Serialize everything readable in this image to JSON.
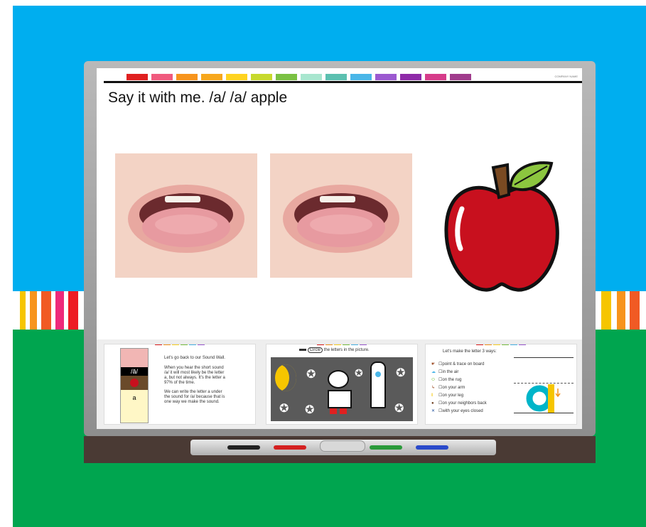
{
  "slide": {
    "title": "Say it with me.  /a/ /a/ apple",
    "corner_label": "COMPANY NAME"
  },
  "panels": {
    "sound_wall": {
      "intro": "Let's go back to our Sound Wall.",
      "line1": "When you hear the short sound",
      "line2": "/a/ it will most likely be the letter",
      "line3": "a, but not always. It's the letter a",
      "line4": "97% of the time.",
      "line5": "We can write the letter a under",
      "line6": "the sound for /a/ because that is",
      "line7": "one way we make the sound.",
      "card_sound": "/ă/",
      "card_letter": "a"
    },
    "circle_letters": {
      "circle_word": "Circle",
      "instruction_rest": "the letters in the picture."
    },
    "three_ways": {
      "heading": "Let's make the letter 3 ways:",
      "items": [
        "point & trace on board",
        "in the air",
        "on the rug",
        "on your arm",
        "on your leg",
        "on your neighbors back",
        "with your eyes closed"
      ]
    }
  },
  "colors": {
    "sky": "#00aeef",
    "grass": "#00a54f",
    "apple_red": "#c8101e",
    "leaf_green": "#8cc63f",
    "letter_teal": "#00b5c9",
    "letter_yellow": "#f6c500"
  },
  "icons": [
    "apple-icon",
    "point-hand-icon",
    "cloud-icon",
    "rug-icon",
    "arm-icon",
    "leg-icon",
    "neighbor-icon",
    "eyes-closed-icon"
  ]
}
